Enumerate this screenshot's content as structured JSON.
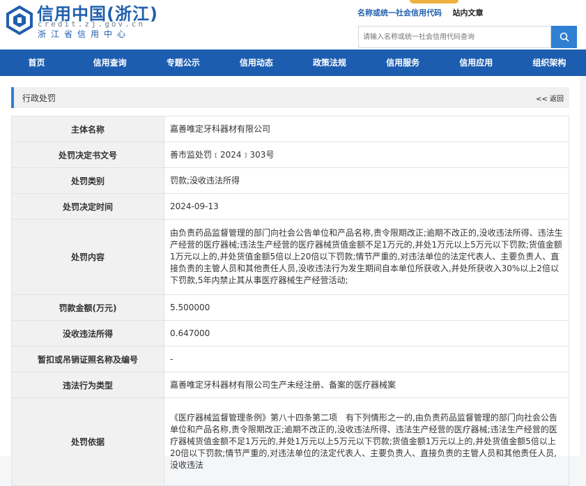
{
  "site": {
    "title": "信用中国(浙江)",
    "domain": "credit.zj.gov.cn",
    "subtitle": "浙江省信用中心"
  },
  "search": {
    "tabs": [
      "名称或统一社会信用代码",
      "站内文章"
    ],
    "placeholder": "请输入名称或统一社会信用代码查询"
  },
  "nav": {
    "items": [
      "首页",
      "信用查询",
      "专题公示",
      "信用动态",
      "政策法规",
      "信用服务",
      "信用应用",
      "组织架构"
    ]
  },
  "section": {
    "title": "行政处罚",
    "back_label": "<< 返回"
  },
  "rows": [
    {
      "label": "主体名称",
      "value": "嘉善唯定牙科器材有限公司"
    },
    {
      "label": "处罚决定书文号",
      "value": "善市监处罚﹝2024﹞303号"
    },
    {
      "label": "处罚类别",
      "value": "罚款;没收违法所得"
    },
    {
      "label": "处罚决定时间",
      "value": "2024-09-13"
    },
    {
      "label": "处罚内容",
      "value": "由负责药品监督管理的部门向社会公告单位和产品名称,责令限期改正;逾期不改正的,没收违法所得、违法生产经营的医疗器械;违法生产经营的医疗器械货值金额不足1万元的,并处1万元以上5万元以下罚款;货值金额1万元以上的,并处货值金额5倍以上20倍以下罚款;情节严重的,对违法单位的法定代表人、主要负责人、直接负责的主管人员和其他责任人员,没收违法行为发生期间自本单位所获收入,并处所获收入30%以上2倍以下罚款,5年内禁止其从事医疗器械生产经营活动;"
    },
    {
      "label": "罚款金额(万元)",
      "value": "5.500000"
    },
    {
      "label": "没收违法所得",
      "value": "0.647000"
    },
    {
      "label": "暂扣或吊销证照名称及编号",
      "value": "-"
    },
    {
      "label": "违法行为类型",
      "value": "嘉善唯定牙科器材有限公司生产未经注册、备案的医疗器械案"
    },
    {
      "label": "处罚依据",
      "value": "《医疗器械监督管理条例》第八十四条第二项　有下列情形之一的,由负责药品监督管理的部门向社会公告单位和产品名称,责令限期改正;逾期不改正的,没收违法所得、违法生产经营的医疗器械;违法生产经营的医疗器械货值金额不足1万元的,并处1万元以上5万元以下罚款;货值金额1万元以上的,并处货值金额5倍以上20倍以下罚款;情节严重的,对违法单位的法定代表人、主要负责人、直接负责的主管人员和其他责任人员,没收违法"
    }
  ],
  "colors": {
    "brand": "#1f5fae",
    "nav_bg": "#1c5db0",
    "search_button": "#2f7fd3",
    "label_bg": "#f1f1f1"
  },
  "icons": {
    "logo": "credit-china-logo-icon",
    "search": "search-icon"
  }
}
